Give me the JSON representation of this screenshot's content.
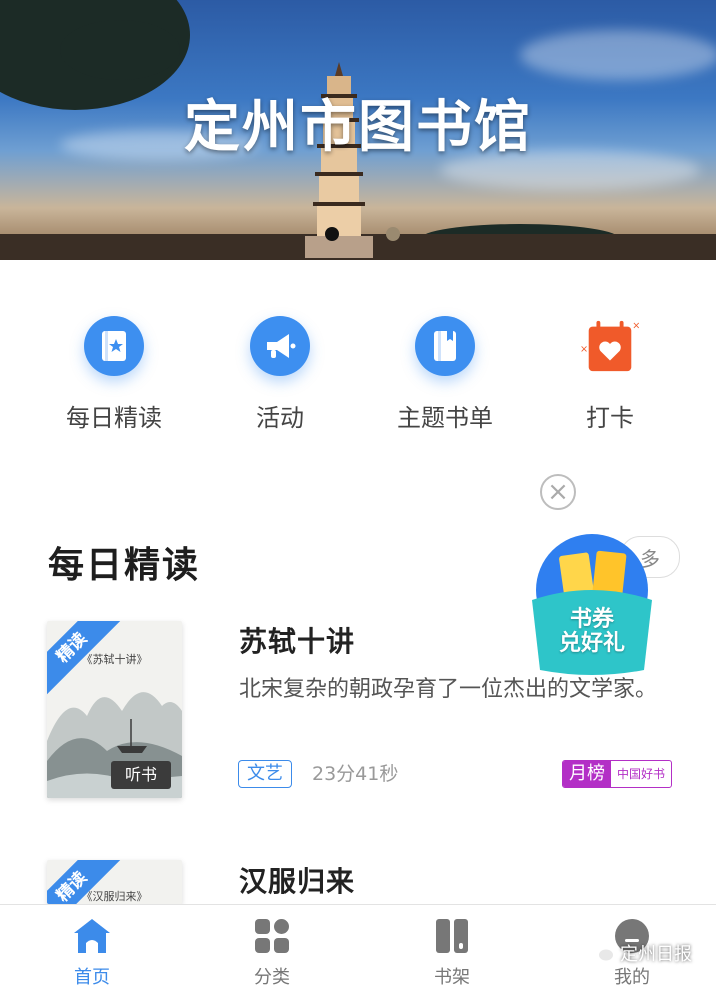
{
  "banner": {
    "title": "定州市图书馆",
    "slides": 2,
    "active_slide": 1
  },
  "quick_menu": [
    {
      "label": "每日精读",
      "icon": "bookmark-book-icon"
    },
    {
      "label": "活动",
      "icon": "megaphone-icon"
    },
    {
      "label": "主题书单",
      "icon": "book-icon"
    },
    {
      "label": "打卡",
      "icon": "calendar-heart-icon"
    }
  ],
  "close_icon": "close-circle-icon",
  "section": {
    "title": "每日精读",
    "more_label": "多"
  },
  "promo": {
    "line1": "书券",
    "line2": "兑好礼"
  },
  "books": [
    {
      "badge": "精读",
      "cover_title": "《苏轼十讲》",
      "cover_listen": "听书",
      "title": "苏轼十讲",
      "description": "北宋复杂的朝政孕育了一位杰出的文学家。",
      "tag": "文艺",
      "duration": "23分41秒",
      "rank_label": "月榜",
      "rank_source": "中国好书"
    },
    {
      "badge": "精读",
      "cover_title": "《汉服归来》",
      "title": "汉服归来"
    }
  ],
  "tabbar": [
    {
      "label": "首页",
      "icon": "home-icon",
      "active": true
    },
    {
      "label": "分类",
      "icon": "grid-icon",
      "active": false
    },
    {
      "label": "书架",
      "icon": "bookshelf-icon",
      "active": false
    },
    {
      "label": "我的",
      "icon": "profile-icon",
      "active": false
    }
  ],
  "watermark": "定州日报",
  "colors": {
    "accent": "#3c8bea",
    "rank": "#b32fc6",
    "calendar": "#f05a2a"
  }
}
